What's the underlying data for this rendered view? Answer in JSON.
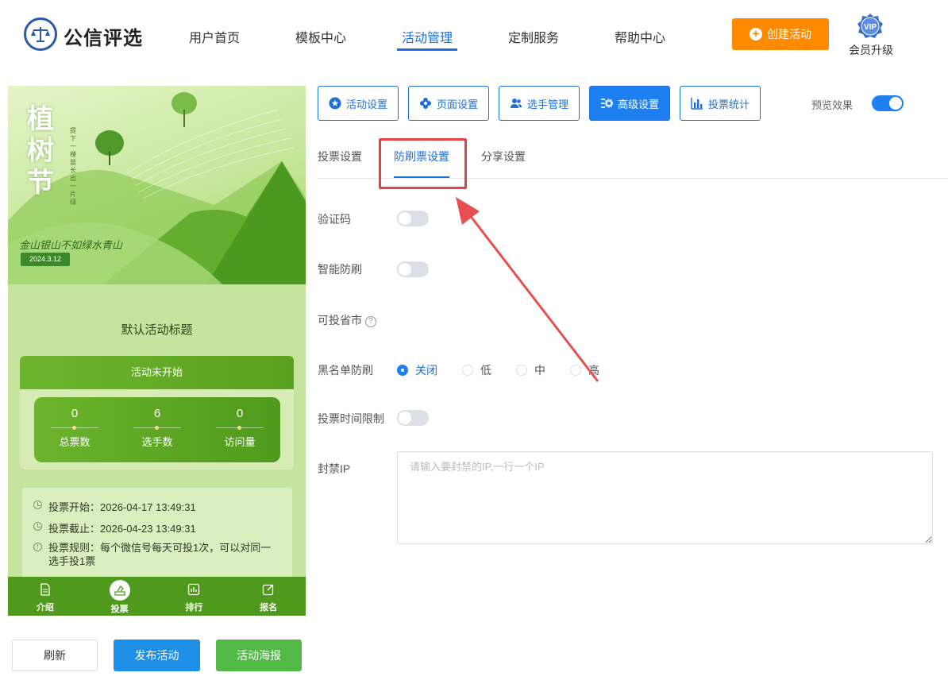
{
  "header": {
    "brand": "公信评选",
    "nav": [
      "用户首页",
      "模板中心",
      "活动管理",
      "定制服务",
      "帮助中心"
    ],
    "active_nav": "活动管理",
    "create_button": "创建活动",
    "vip_badge": "VIP",
    "vip_label": "会员升级",
    "brand_color": "#1e6fd9",
    "accent_color": "#ff8a00"
  },
  "preview": {
    "banner_title": "植树节",
    "banner_vertical": "提下一棵苗长出一片绿",
    "banner_slogan": "金山银山不如绿水青山",
    "banner_date": "2024.3.12",
    "activity_title": "默认活动标题",
    "status": "活动未开始",
    "stats": [
      {
        "value": "0",
        "label": "总票数"
      },
      {
        "value": "6",
        "label": "选手数"
      },
      {
        "value": "0",
        "label": "访问量"
      }
    ],
    "info": {
      "start": "投票开始：2026-04-17 13:49:31",
      "end": "投票截止：2026-04-23 13:49:31",
      "rule_line1": "投票规则：每个微信号每天可投1次，可以对同一",
      "rule_line2": "选手投1票"
    },
    "bottom_nav": [
      "介绍",
      "投票",
      "排行",
      "报名"
    ],
    "active_bottom_nav": "投票"
  },
  "actions": {
    "refresh": "刷新",
    "publish": "发布活动",
    "poster": "活动海报"
  },
  "settings": {
    "tabs": [
      "活动设置",
      "页面设置",
      "选手管理",
      "高级设置",
      "投票统计"
    ],
    "active_tab": "高级设置",
    "preview_label": "预览效果",
    "preview_on": true,
    "subtabs": [
      "投票设置",
      "防刷票设置",
      "分享设置"
    ],
    "active_subtab": "防刷票设置",
    "fields": {
      "captcha": "验证码",
      "smart_antibrush": "智能防刷",
      "allowed_regions": "可投省市",
      "blacklist": "黑名单防刷",
      "time_limit": "投票时间限制",
      "ban_ip": "封禁IP"
    },
    "blacklist_options": [
      "关闭",
      "低",
      "中",
      "高"
    ],
    "blacklist_selected": "关闭",
    "ip_placeholder": "请输入要封禁的IP,一行一个IP",
    "ip_value": ""
  }
}
